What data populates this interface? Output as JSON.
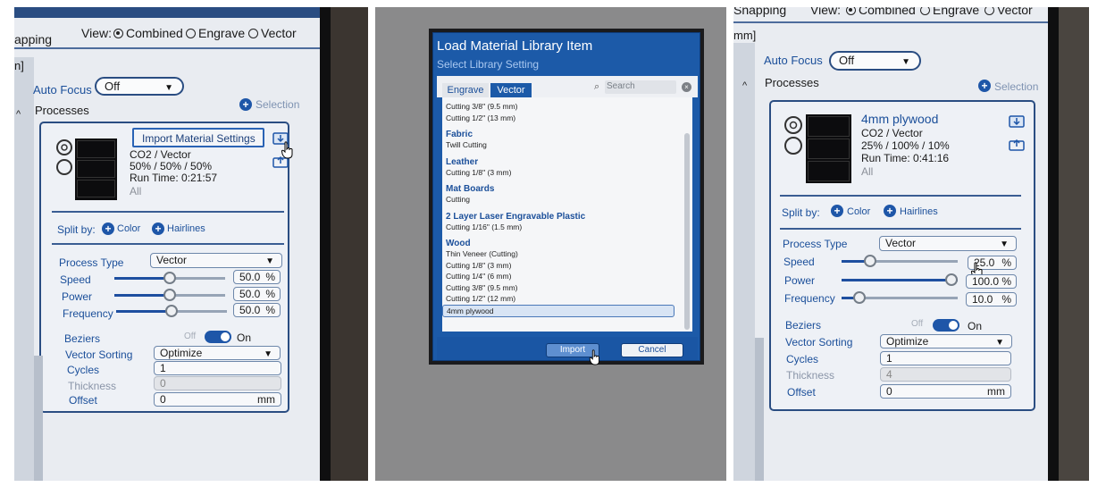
{
  "left": {
    "toolbar": {
      "snapping_label": "apping",
      "view_label": "View:",
      "view_options": [
        "Combined",
        "Engrave",
        "Vector"
      ],
      "view_selected": "Combined"
    },
    "side_label": "n]",
    "auto_focus": {
      "label": "Auto Focus",
      "value": "Off"
    },
    "processes_label": "Processes",
    "selection_label": "Selection",
    "tooltip": "Import Material Settings",
    "process": {
      "type_line": "CO2 / Vector",
      "settings_line": "50% / 50% / 50%",
      "runtime_line": "Run Time: 0:21:57",
      "scope": "All"
    },
    "split_by": {
      "label": "Split by:",
      "color": "Color",
      "hairlines": "Hairlines"
    },
    "process_type": {
      "label": "Process Type",
      "value": "Vector"
    },
    "speed": {
      "label": "Speed",
      "value": "50.0",
      "unit": "%"
    },
    "power": {
      "label": "Power",
      "value": "50.0",
      "unit": "%"
    },
    "frequency": {
      "label": "Frequency",
      "value": "50.0",
      "unit": "%"
    },
    "beziers": {
      "label": "Beziers",
      "off": "Off",
      "on": "On"
    },
    "vector_sorting": {
      "label": "Vector Sorting",
      "value": "Optimize"
    },
    "cycles": {
      "label": "Cycles",
      "value": "1"
    },
    "thickness": {
      "label": "Thickness",
      "value": "0"
    },
    "offset": {
      "label": "Offset",
      "value": "0",
      "unit": "mm"
    }
  },
  "dialog": {
    "title": "Load Material Library Item",
    "subtitle": "Select Library Setting",
    "tabs": [
      "Engrave",
      "Vector"
    ],
    "active_tab": "Vector",
    "search_placeholder": "Search",
    "top_items": [
      "Cutting 3/8\" (9.5 mm)",
      "Cutting 1/2\" (13 mm)"
    ],
    "groups": [
      {
        "name": "Fabric",
        "items": [
          "Twill Cutting"
        ]
      },
      {
        "name": "Leather",
        "items": [
          "Cutting 1/8\" (3 mm)"
        ]
      },
      {
        "name": "Mat Boards",
        "items": [
          "Cutting"
        ]
      },
      {
        "name": "2 Layer Laser Engravable Plastic",
        "items": [
          "Cutting 1/16\" (1.5 mm)"
        ]
      },
      {
        "name": "Wood",
        "items": [
          "Thin Veneer (Cutting)",
          "Cutting 1/8\" (3 mm)",
          "Cutting 1/4\" (6 mm)",
          "Cutting 3/8\" (9.5 mm)",
          "Cutting 1/2\" (12 mm)",
          "4mm plywood"
        ]
      }
    ],
    "selected_item": "4mm plywood",
    "import_label": "Import",
    "cancel_label": "Cancel"
  },
  "right": {
    "toolbar": {
      "snapping_label": "Snapping",
      "view_label": "View:",
      "view_options": [
        "Combined",
        "Engrave",
        "Vector"
      ],
      "view_selected": "Combined"
    },
    "side_label": "mm]",
    "auto_focus": {
      "label": "Auto Focus",
      "value": "Off"
    },
    "processes_label": "Processes",
    "selection_label": "Selection",
    "process": {
      "name": "4mm plywood",
      "type_line": "CO2 / Vector",
      "settings_line": "25% / 100% / 10%",
      "runtime_line": "Run Time: 0:41:16",
      "scope": "All"
    },
    "split_by": {
      "label": "Split by:",
      "color": "Color",
      "hairlines": "Hairlines"
    },
    "process_type": {
      "label": "Process Type",
      "value": "Vector"
    },
    "speed": {
      "label": "Speed",
      "value": "25.0",
      "unit": "%"
    },
    "power": {
      "label": "Power",
      "value": "100.0",
      "unit": "%"
    },
    "frequency": {
      "label": "Frequency",
      "value": "10.0",
      "unit": "%"
    },
    "beziers": {
      "label": "Beziers",
      "off": "Off",
      "on": "On"
    },
    "vector_sorting": {
      "label": "Vector Sorting",
      "value": "Optimize"
    },
    "cycles": {
      "label": "Cycles",
      "value": "1"
    },
    "thickness": {
      "label": "Thickness",
      "value": "4"
    },
    "offset": {
      "label": "Offset",
      "value": "0",
      "unit": "mm"
    }
  },
  "colors": {
    "ui_blue": "#1e56a8",
    "label_blue": "#1b4f9a",
    "panel_bg": "#e9ecf1"
  }
}
